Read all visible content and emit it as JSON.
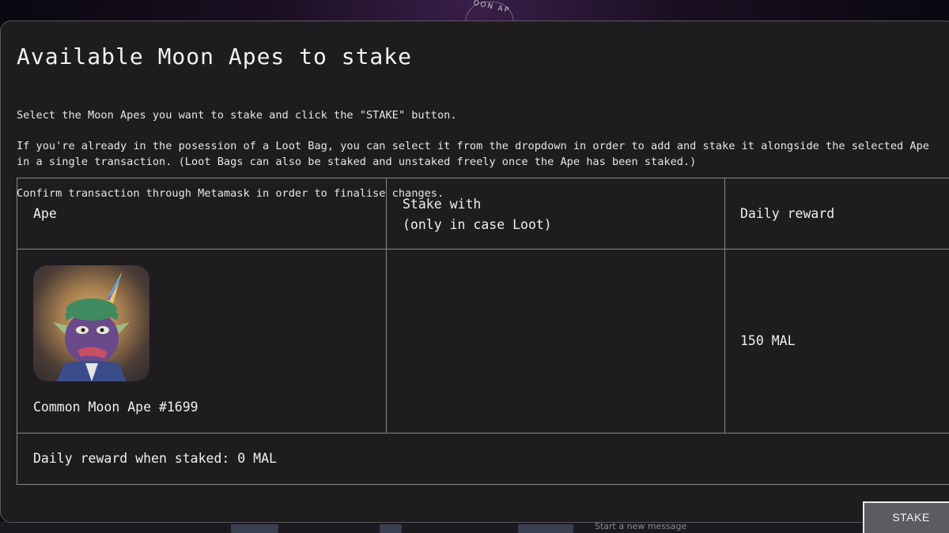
{
  "brand": {
    "badge_text": "OON AP"
  },
  "modal": {
    "title": "Available Moon Apes to stake",
    "instructions": [
      "Select the Moon Apes you want to stake and click the \"STAKE\" button.",
      "If you're already in the posession of a Loot Bag, you can select it from the dropdown in order to add and stake it alongside the selected Ape in a single transaction. (Loot Bags can also be staked and unstaked freely once the Ape has been staked.)",
      "Confirm transaction through Metamask in order to finalise changes."
    ],
    "table": {
      "headers": {
        "ape": "Ape",
        "stake_with": "Stake with\n(only in case Loot)",
        "daily_reward": "Daily reward"
      },
      "rows": [
        {
          "ape_name": "Common Moon Ape #1699",
          "stake_with": "",
          "daily_reward": "150 MAL"
        }
      ],
      "summary": "Daily reward when staked: 0 MAL"
    },
    "stake_button": "STAKE"
  },
  "background": {
    "bottom_message": "Start a new message"
  },
  "colors": {
    "modal_bg": "#1f1c20",
    "border": "#8a878c",
    "button_bg": "#5d5b60"
  }
}
